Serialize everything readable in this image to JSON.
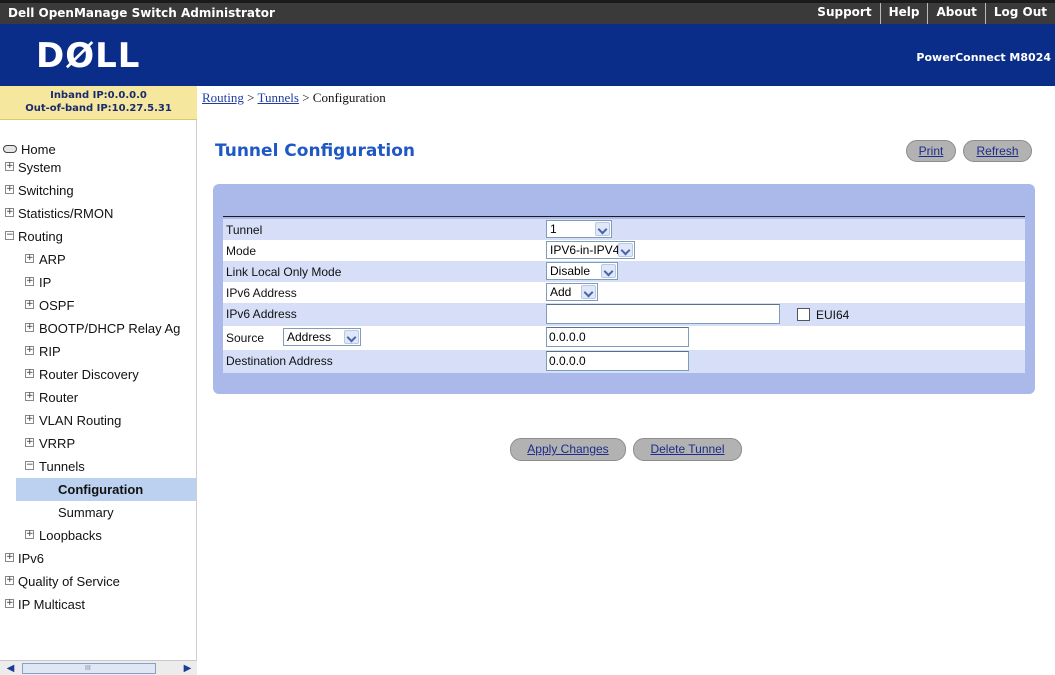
{
  "topbar": {
    "title": "Dell OpenManage Switch Administrator",
    "links": {
      "support": "Support",
      "help": "Help",
      "about": "About",
      "logout": "Log Out"
    }
  },
  "brand": {
    "logo": "DØLL",
    "model": "PowerConnect M8024"
  },
  "ip": {
    "inband": "Inband IP:0.0.0.0",
    "oob": "Out-of-band IP:10.27.5.31"
  },
  "nav": {
    "home": "Home",
    "system": "System",
    "switching": "Switching",
    "statistics": "Statistics/RMON",
    "routing": "Routing",
    "arp": "ARP",
    "ip": "IP",
    "ospf": "OSPF",
    "bootp": "BOOTP/DHCP Relay Ag",
    "rip": "RIP",
    "router_discovery": "Router Discovery",
    "router": "Router",
    "vlan_routing": "VLAN Routing",
    "vrrp": "VRRP",
    "tunnels": "Tunnels",
    "configuration": "Configuration",
    "summary": "Summary",
    "loopbacks": "Loopbacks",
    "ipv6": "IPv6",
    "qos": "Quality of Service",
    "ip_multicast": "IP Multicast"
  },
  "breadcrumb": {
    "routing": "Routing",
    "sep1": " > ",
    "tunnels": "Tunnels",
    "sep2": " > ",
    "current": "Configuration"
  },
  "page": {
    "title": "Tunnel Configuration",
    "print": "Print",
    "refresh": "Refresh"
  },
  "form": {
    "tunnel_label": "Tunnel",
    "tunnel_value": "1",
    "mode_label": "Mode",
    "mode_value": "IPV6-in-IPV4",
    "link_local_label": "Link Local Only Mode",
    "link_local_value": "Disable",
    "ipv6_action_label": "IPv6 Address",
    "ipv6_action_value": "Add",
    "ipv6_addr_label": "IPv6 Address",
    "ipv6_addr_value": "",
    "eui64_label": "EUI64",
    "source_label": "Source",
    "source_type_value": "Address",
    "source_value": "0.0.0.0",
    "dest_label": "Destination Address",
    "dest_value": "0.0.0.0"
  },
  "actions": {
    "apply": "Apply Changes",
    "delete": "Delete Tunnel"
  },
  "scrollbar": {
    "grip": "III"
  }
}
